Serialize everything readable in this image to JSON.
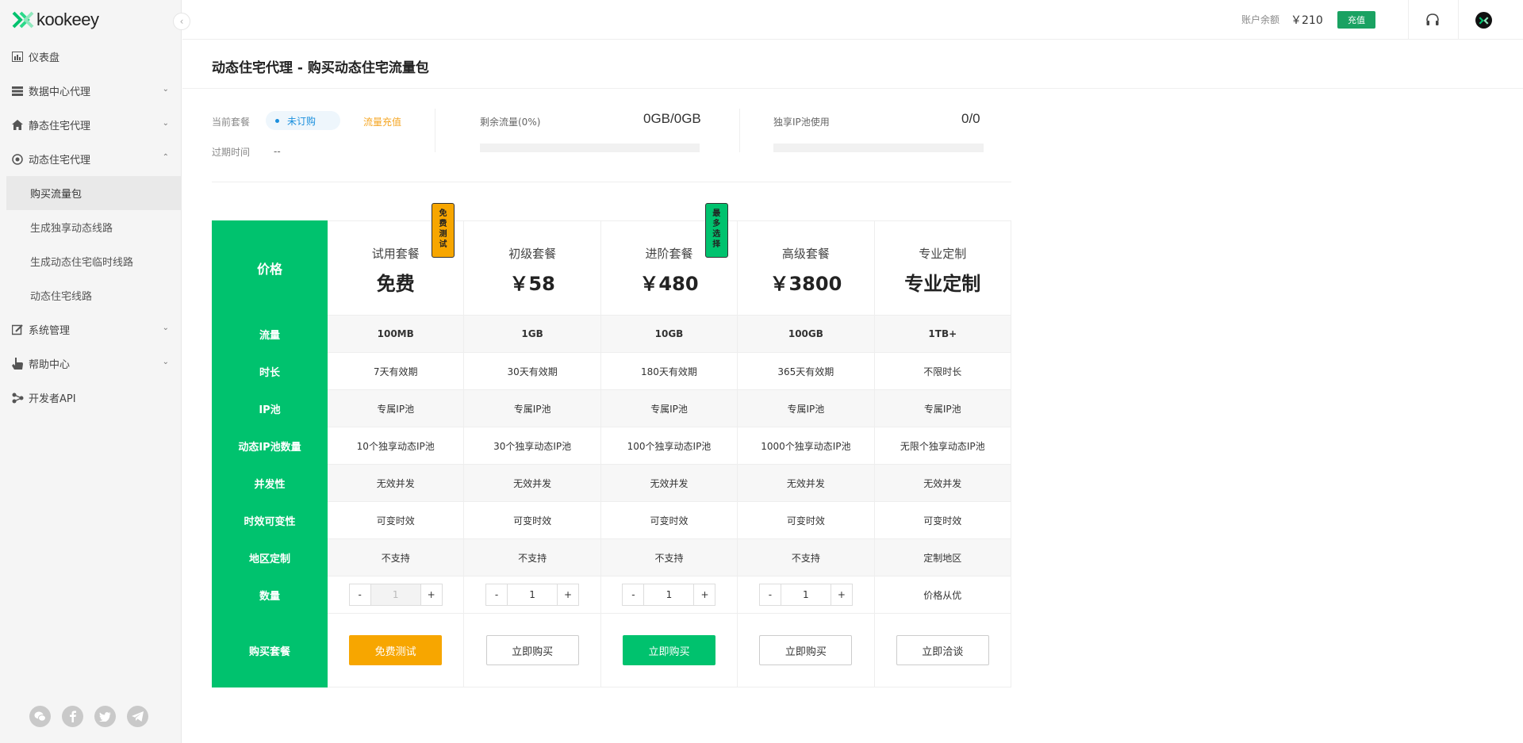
{
  "brand": {
    "name": "kookeey"
  },
  "sidebar": {
    "items": [
      {
        "label": "仪表盘",
        "icon": "dashboard-icon"
      },
      {
        "label": "数据中心代理",
        "icon": "server-icon"
      },
      {
        "label": "静态住宅代理",
        "icon": "home-icon"
      },
      {
        "label": "动态住宅代理",
        "icon": "globe-icon"
      },
      {
        "label": "系统管理",
        "icon": "edit-icon"
      },
      {
        "label": "帮助中心",
        "icon": "hand-icon"
      },
      {
        "label": "开发者API",
        "icon": "api-icon"
      }
    ],
    "subitems": [
      "购买流量包",
      "生成独享动态线路",
      "生成动态住宅临时线路",
      "动态住宅线路"
    ]
  },
  "topbar": {
    "balance_label": "账户余额",
    "balance_value": "￥210",
    "recharge": "充值"
  },
  "page": {
    "title": "动态住宅代理 - 购买动态住宅流量包"
  },
  "info": {
    "plan_label": "当前套餐",
    "plan_status": "未订购",
    "topup_link": "流量充值",
    "expiry_label": "过期时间",
    "expiry_value": "--",
    "traffic_label": "剩余流量(0%)",
    "traffic_value": "0GB/0GB",
    "traffic_progress": 0,
    "pool_label": "独享IP池使用",
    "pool_value": "0/0",
    "pool_progress": 0
  },
  "table": {
    "row_labels": {
      "price": "价格",
      "traffic": "流量",
      "duration": "时长",
      "pool": "IP池",
      "pool_count": "动态IP池数量",
      "concurrency": "并发性",
      "timing": "时效可变性",
      "region": "地区定制",
      "quantity": "数量",
      "buy": "购买套餐"
    },
    "ribbons": {
      "free": [
        "免",
        "费",
        "测",
        "试"
      ],
      "best": [
        "最",
        "多",
        "选",
        "择"
      ]
    },
    "plans": [
      {
        "name": "试用套餐",
        "price": "免费",
        "traffic": "100MB",
        "duration": "7天有效期",
        "pool": "专属IP池",
        "pool_count": "10个独享动态IP池",
        "concurrency": "无效并发",
        "timing": "可变时效",
        "region": "不支持",
        "qty": "1",
        "button": "免费测试"
      },
      {
        "name": "初级套餐",
        "price": "￥58",
        "traffic": "1GB",
        "duration": "30天有效期",
        "pool": "专属IP池",
        "pool_count": "30个独享动态IP池",
        "concurrency": "无效并发",
        "timing": "可变时效",
        "region": "不支持",
        "qty": "1",
        "button": "立即购买"
      },
      {
        "name": "进阶套餐",
        "price": "￥480",
        "traffic": "10GB",
        "duration": "180天有效期",
        "pool": "专属IP池",
        "pool_count": "100个独享动态IP池",
        "concurrency": "无效并发",
        "timing": "可变时效",
        "region": "不支持",
        "qty": "1",
        "button": "立即购买"
      },
      {
        "name": "高级套餐",
        "price": "￥3800",
        "traffic": "100GB",
        "duration": "365天有效期",
        "pool": "专属IP池",
        "pool_count": "1000个独享动态IP池",
        "concurrency": "无效并发",
        "timing": "可变时效",
        "region": "不支持",
        "qty": "1",
        "button": "立即购买"
      },
      {
        "name": "专业定制",
        "price": "专业定制",
        "traffic": "1TB+",
        "duration": "不限时长",
        "pool": "专属IP池",
        "pool_count": "无限个独享动态IP池",
        "concurrency": "无效并发",
        "timing": "可变时效",
        "region": "定制地区",
        "qty_text": "价格从优",
        "button": "立即洽谈"
      }
    ]
  },
  "colors": {
    "accent": "#00c26e",
    "orange": "#f7a600",
    "link": "#1a8fdd"
  }
}
